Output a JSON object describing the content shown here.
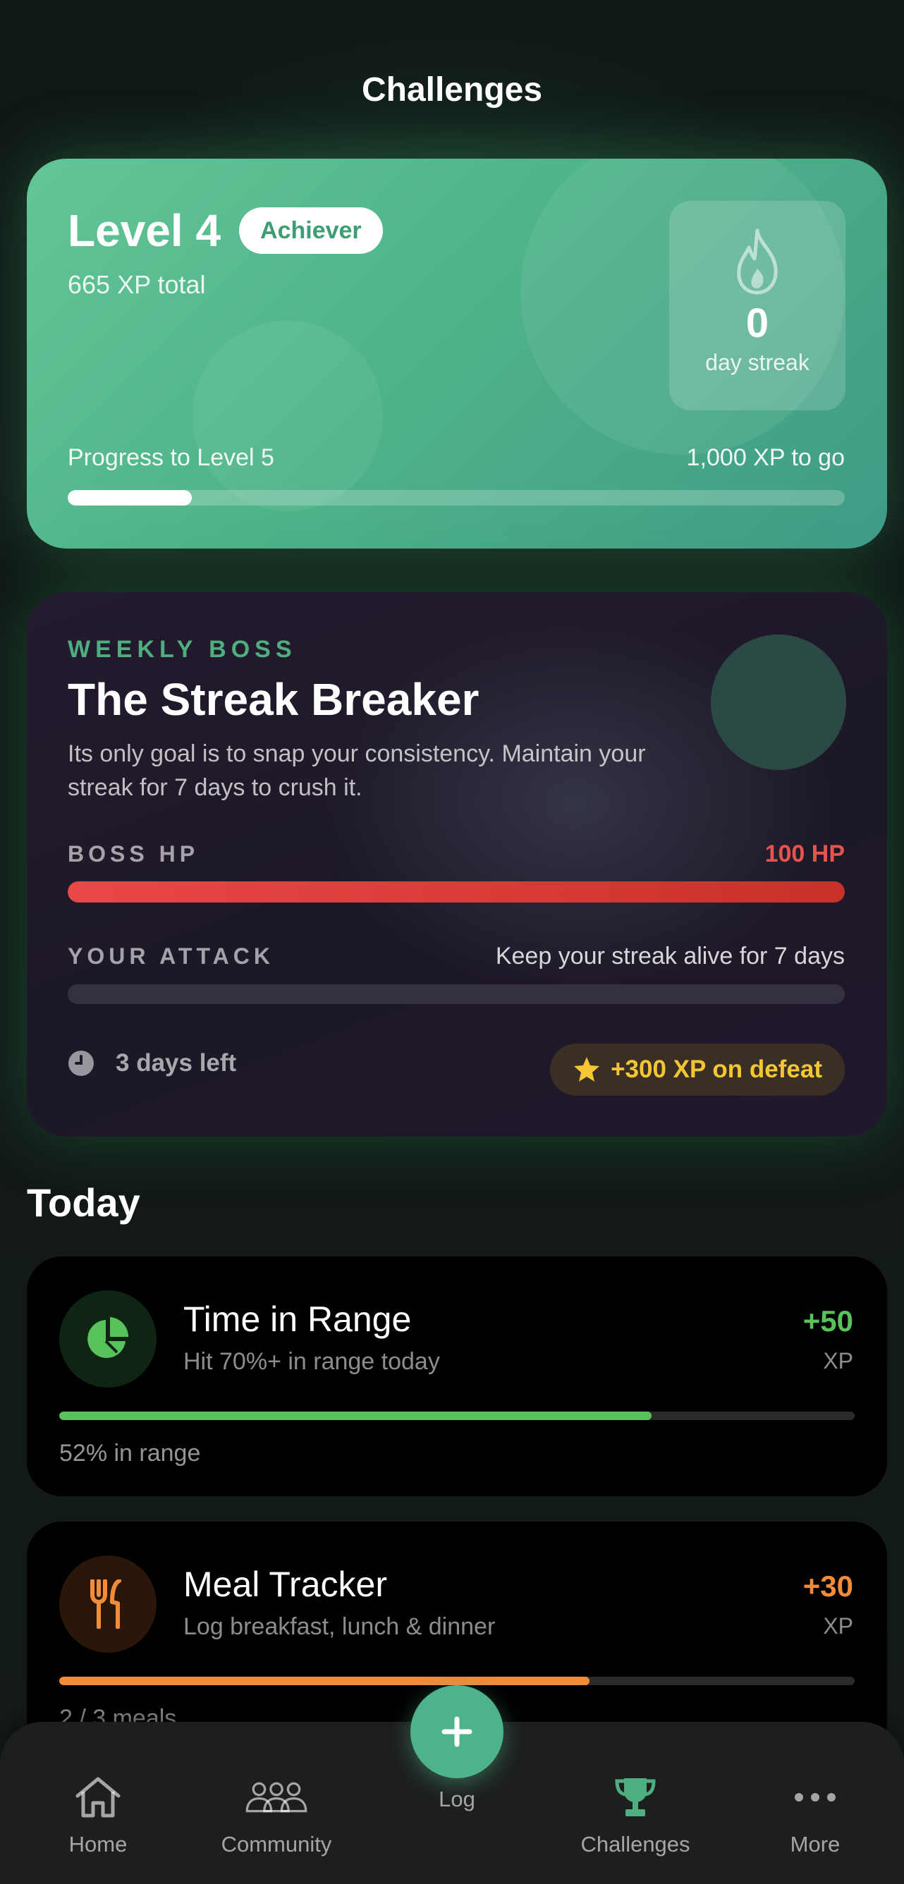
{
  "page": {
    "title": "Challenges"
  },
  "level_card": {
    "level_title": "Level 4",
    "badge": "Achiever",
    "xp_total": "665 XP total",
    "streak_value": "0",
    "streak_label": "day streak",
    "progress_label": "Progress to Level 5",
    "progress_remaining": "1,000 XP to go",
    "progress_fraction": 0.16
  },
  "boss": {
    "eyebrow": "WEEKLY BOSS",
    "name": "The Streak Breaker",
    "description": "Its only goal is to snap your consistency. Maintain your streak for 7 days to crush it.",
    "hp_label": "BOSS HP",
    "hp_value": "100 HP",
    "hp_fraction": 1.0,
    "attack_label": "YOUR ATTACK",
    "attack_goal": "Keep your streak alive for 7 days",
    "attack_fraction": 0.0,
    "time_left": "3 days left",
    "reward": "+300 XP on defeat"
  },
  "today": {
    "title": "Today",
    "challenges": [
      {
        "title": "Time in Range",
        "subtitle": "Hit 70%+ in range today",
        "xp": "+50",
        "xp_unit": "XP",
        "status": "52% in range",
        "progress_fraction": 0.745,
        "color": "#58c25b",
        "icon": "pie-chart-icon"
      },
      {
        "title": "Meal Tracker",
        "subtitle": "Log breakfast, lunch & dinner",
        "xp": "+30",
        "xp_unit": "XP",
        "status": "2 / 3 meals",
        "progress_fraction": 0.667,
        "color": "#f28c38",
        "icon": "fork-knife-icon"
      }
    ]
  },
  "tab_bar": {
    "items": [
      {
        "label": "Home",
        "icon": "home-icon",
        "active": false
      },
      {
        "label": "Community",
        "icon": "community-icon",
        "active": false
      },
      {
        "label": "Log",
        "icon": "plus-icon",
        "active": false
      },
      {
        "label": "Challenges",
        "icon": "trophy-icon",
        "active": true
      },
      {
        "label": "More",
        "icon": "more-icon",
        "active": false
      }
    ]
  },
  "colors": {
    "accent": "#4fae7f",
    "boss_hp": "#e8534f",
    "reward": "#f5c634"
  }
}
